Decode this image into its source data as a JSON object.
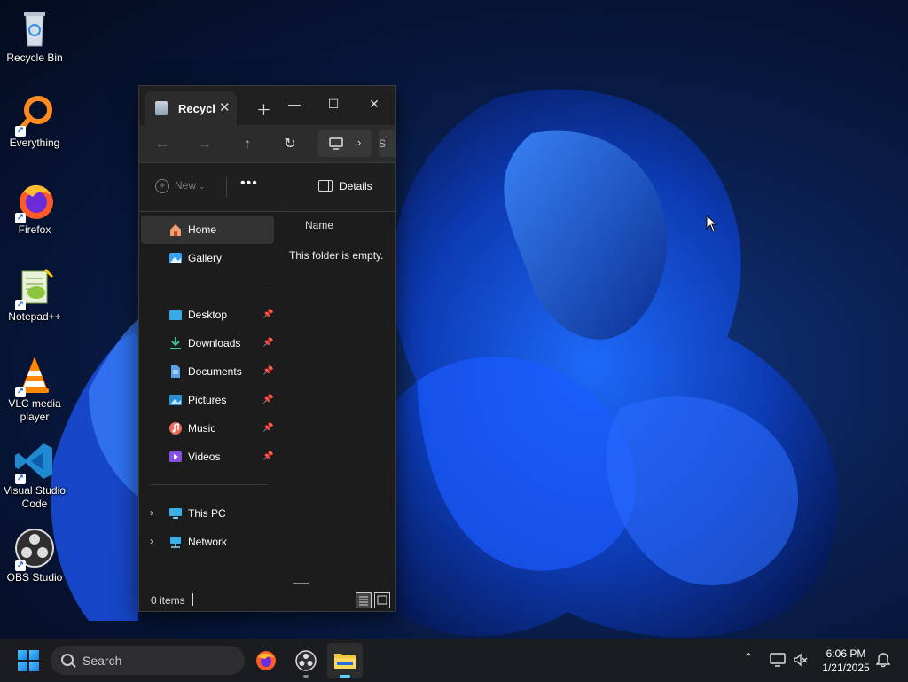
{
  "desktop": {
    "icons": [
      {
        "label": "Recycle Bin",
        "icon": "recycle-bin-icon"
      },
      {
        "label": "Everything",
        "icon": "everything-search-icon"
      },
      {
        "label": "Firefox",
        "icon": "firefox-icon"
      },
      {
        "label": "Notepad++",
        "icon": "notepad-plus-plus-icon"
      },
      {
        "label": "VLC media player",
        "icon": "vlc-icon"
      },
      {
        "label": "Visual Studio Code",
        "icon": "vscode-icon"
      },
      {
        "label": "OBS Studio",
        "icon": "obs-icon"
      }
    ]
  },
  "explorer": {
    "tab_title": "Recycl",
    "address_hint": "S",
    "toolbar": {
      "new_label": "New",
      "more_label": "•••",
      "details_label": "Details"
    },
    "nav": {
      "items": [
        {
          "label": "Home",
          "selected": true
        },
        {
          "label": "Gallery"
        },
        {
          "label": "Desktop",
          "pinned": true
        },
        {
          "label": "Downloads",
          "pinned": true
        },
        {
          "label": "Documents",
          "pinned": true
        },
        {
          "label": "Pictures",
          "pinned": true
        },
        {
          "label": "Music",
          "pinned": true
        },
        {
          "label": "Videos",
          "pinned": true
        },
        {
          "label": "This PC"
        },
        {
          "label": "Network"
        }
      ]
    },
    "content": {
      "column_name": "Name",
      "empty_message": "This folder is empty."
    },
    "status": {
      "items_count": "0 items"
    }
  },
  "taskbar": {
    "search_placeholder": "Search",
    "clock": {
      "time": "6:06 PM",
      "date": "1/21/2025"
    }
  },
  "colors": {
    "accent": "#60cdff",
    "window_bg": "#1c1c1c",
    "taskbar_bg": "#1b1c20"
  }
}
